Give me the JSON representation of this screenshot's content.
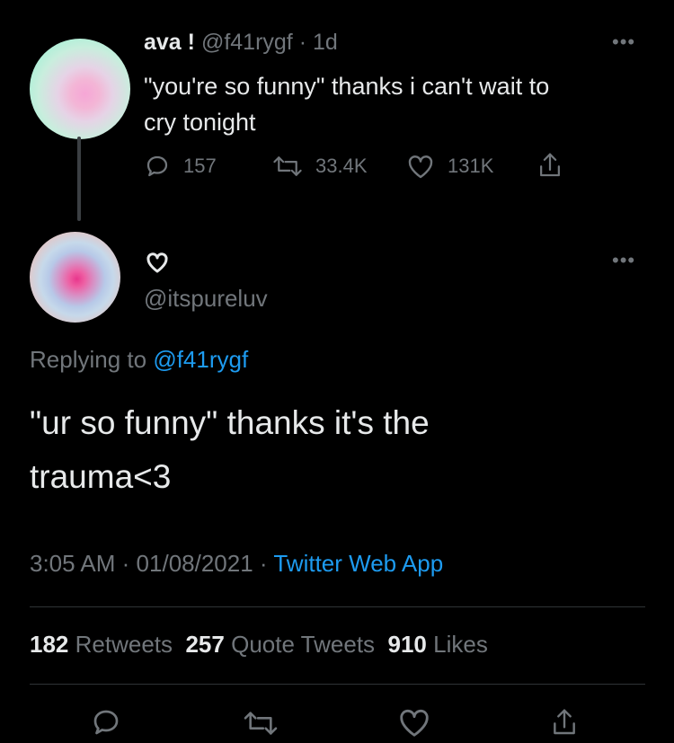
{
  "tweet1": {
    "display_name": "ava !",
    "handle": "@f41rygf",
    "separator": "·",
    "age": "1d",
    "text_line1": "\"you're so funny\" thanks i can't wait to",
    "text_line2": "cry tonight",
    "reply_count": "157",
    "retweet_count": "33.4K",
    "like_count": "131K"
  },
  "tweet2": {
    "display_name_icon": "heart-outline",
    "handle": "@itspureluv",
    "replying_prefix": "Replying to",
    "replying_handle": "@f41rygf",
    "text_line1": "\"ur so funny\" thanks it's the",
    "text_line2": "trauma<3",
    "time": "3:05 AM",
    "dot1": "·",
    "date": "01/08/2021",
    "dot2": "·",
    "client": "Twitter Web App"
  },
  "stats": {
    "retweets_count": "182",
    "retweets_label": "Retweets",
    "quote_count": "257",
    "quote_label": "Quote Tweets",
    "likes_count": "910",
    "likes_label": "Likes"
  },
  "colors": {
    "background": "#000000",
    "text": "#e7e9ea",
    "muted": "#71767b",
    "link": "#1d9bf0",
    "divider": "#2f3336"
  }
}
